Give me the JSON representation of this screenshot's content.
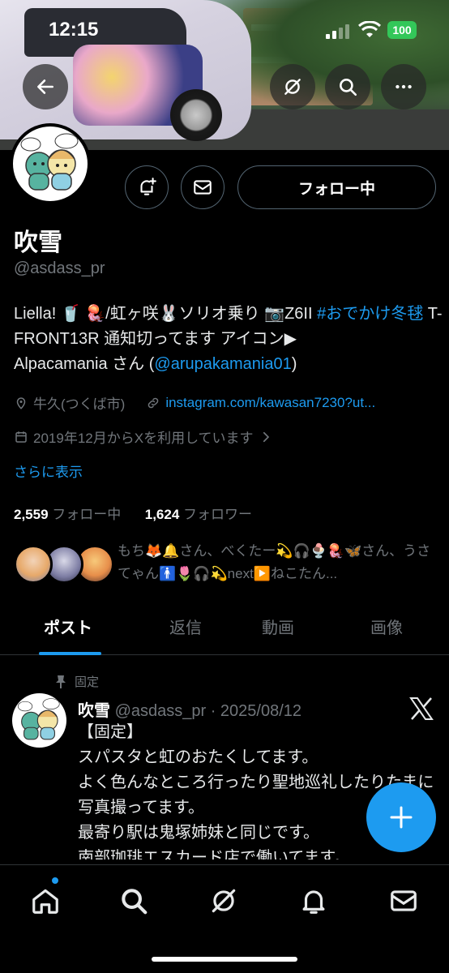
{
  "status": {
    "time": "12:15",
    "battery": "100"
  },
  "profile": {
    "name": "吹雪",
    "handle": "@asdass_pr",
    "follow_label": "フォロー中",
    "bio_line1_a": "Liella! 🥤 🪼/虹ヶ咲🐰ソリオ乗り 📷Z6II ",
    "bio_hashtag": "#おでかけ冬毬",
    "bio_line2": " T-FRONT13R 通知切ってます アイコン▶",
    "bio_line3_a": "Alpacamania さん (",
    "bio_mention": "@arupakamania01",
    "bio_line3_b": ")",
    "location": "牛久(つくば市)",
    "website": "instagram.com/kawasan7230?ut...",
    "joined": "2019年12月からXを利用しています",
    "show_more": "さらに表示",
    "following_count": "2,559",
    "following_label": "フォロー中",
    "followers_count": "1,624",
    "followers_label": "フォロワー",
    "followed_by": "もち🦊🔔さん、べくたー💫🎧🍨🪼🦋さん、うさてゃん🚹🌷🎧💫next▶️ねこたん..."
  },
  "tabs": [
    {
      "label": "ポスト"
    },
    {
      "label": "返信"
    },
    {
      "label": "動画"
    },
    {
      "label": "画像"
    }
  ],
  "post": {
    "pinned_label": "固定",
    "name": "吹雪",
    "meta": "@asdass_pr · 2025/08/12",
    "lines": [
      "【固定】",
      "スパスタと虹のおたくしてます。",
      "よく色んなところ行ったり聖地巡礼したりたまに写真撮ってます。",
      "最寄り駅は鬼塚姉妹と同じです。",
      "南部珈琲エスカード店で働いてます。"
    ]
  },
  "icons": {
    "back": "back-arrow-icon",
    "grok": "grok-icon",
    "search": "search-icon",
    "more": "more-icon",
    "notify": "notification-bell-plus-icon",
    "message": "mail-icon",
    "location": "location-pin-icon",
    "link": "link-icon",
    "calendar": "calendar-icon",
    "pin": "pin-icon",
    "x_logo": "x-logo-icon",
    "compose": "plus-icon"
  },
  "colors": {
    "accent": "#1d9bf0",
    "muted": "#71767b",
    "battery": "#33c759"
  }
}
